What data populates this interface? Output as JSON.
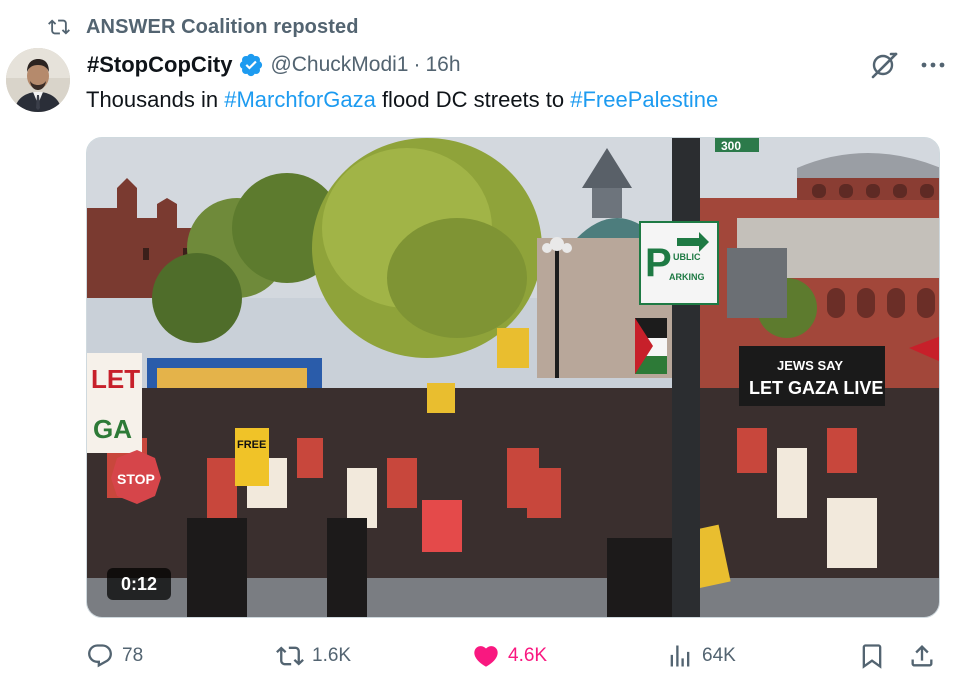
{
  "repost": {
    "label": "ANSWER Coalition reposted",
    "icon": "repost-icon"
  },
  "author": {
    "name": "#StopCopCity",
    "handle": "@ChuckModi1",
    "separator": "·",
    "time": "16h",
    "verified_icon": "verified-badge-icon",
    "avatar_icon": "avatar"
  },
  "tweet": {
    "text_1": "Thousands in ",
    "hashtag_1": "#MarchforGaza",
    "text_2": " flood DC streets to ",
    "hashtag_2": "#FreePalestine"
  },
  "media": {
    "duration": "0:12",
    "signs": {
      "parking_p": "P",
      "parking_ublic": "UBLIC",
      "parking_arking": "ARKING",
      "street_number": "300",
      "banner_line1": "JEWS SAY",
      "banner_line2": "LET GAZA LIVE",
      "sign_free": "FREE",
      "sign_stop": "STOP",
      "sign_let": "LET",
      "sign_ga": "GA"
    }
  },
  "actions": {
    "replies": "78",
    "reposts": "1.6K",
    "likes": "4.6K",
    "views": "64K"
  },
  "colors": {
    "link": "#1d9bf0",
    "muted": "#536471",
    "like": "#f91880",
    "verified": "#1d9bf0"
  }
}
